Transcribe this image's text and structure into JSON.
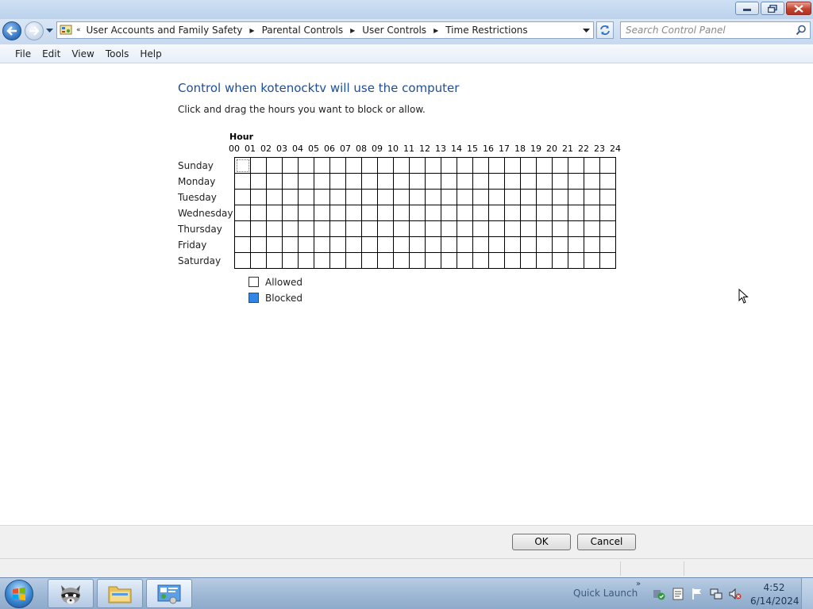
{
  "window": {
    "controls": {
      "minimize": "minimize",
      "restore": "restore",
      "close": "close"
    }
  },
  "address_bar": {
    "overflow": "«",
    "breadcrumbs": [
      "User Accounts and Family Safety",
      "Parental Controls",
      "User Controls",
      "Time Restrictions"
    ]
  },
  "search": {
    "placeholder": "Search Control Panel",
    "value": ""
  },
  "menu": {
    "items": [
      "File",
      "Edit",
      "View",
      "Tools",
      "Help"
    ]
  },
  "main": {
    "title": "Control when kotenocktv will use the computer",
    "instruction": "Click and drag the hours you want to block or allow.",
    "hour_label": "Hour",
    "hours": [
      "00",
      "01",
      "02",
      "03",
      "04",
      "05",
      "06",
      "07",
      "08",
      "09",
      "10",
      "11",
      "12",
      "13",
      "14",
      "15",
      "16",
      "17",
      "18",
      "19",
      "20",
      "21",
      "22",
      "23",
      "24"
    ],
    "days": [
      "Sunday",
      "Monday",
      "Tuesday",
      "Wednesday",
      "Thursday",
      "Friday",
      "Saturday"
    ],
    "blocked_hours": {
      "Sunday": [],
      "Monday": [],
      "Tuesday": [],
      "Wednesday": [],
      "Thursday": [],
      "Friday": [],
      "Saturday": []
    },
    "legend": {
      "allowed": "Allowed",
      "blocked": "Blocked"
    },
    "colors": {
      "allowed": "#ffffff",
      "blocked": "#2f86e6",
      "title": "#1e4e9c"
    }
  },
  "buttons": {
    "ok": "OK",
    "cancel": "Cancel"
  },
  "taskbar": {
    "quick_launch": "Quick Launch",
    "clock_time": "4:52",
    "clock_date": "6/14/2024",
    "apps": [
      "raccoon-app-icon",
      "folder-icon",
      "control-panel-icon"
    ]
  }
}
